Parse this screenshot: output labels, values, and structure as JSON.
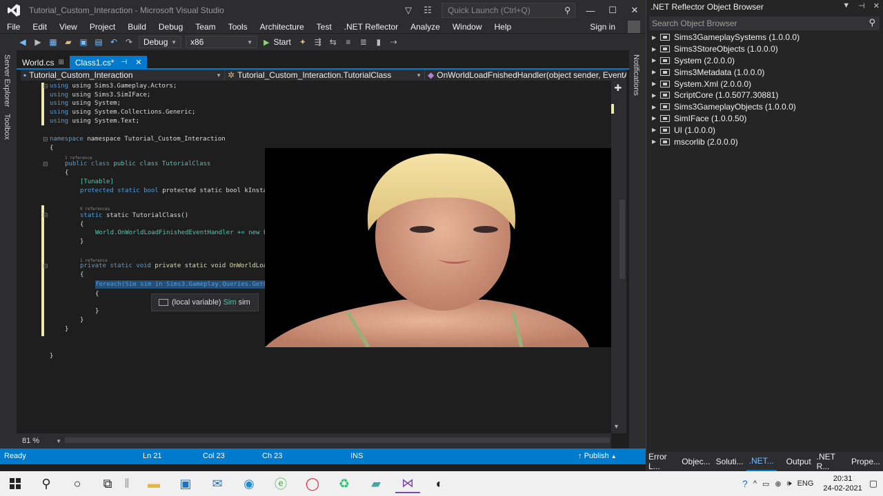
{
  "window": {
    "title": "Tutorial_Custom_Interaction - Microsoft Visual Studio",
    "quick_launch_placeholder": "Quick Launch (Ctrl+Q)",
    "sign_in": "Sign in"
  },
  "menu": [
    "File",
    "Edit",
    "View",
    "Project",
    "Build",
    "Debug",
    "Team",
    "Tools",
    "Architecture",
    "Test",
    ".NET Reflector",
    "Analyze",
    "Window",
    "Help"
  ],
  "toolbar": {
    "config": "Debug",
    "platform": "x86",
    "start_label": "Start"
  },
  "side_tabs": {
    "left": [
      "Server Explorer",
      "Toolbox"
    ],
    "right": [
      "Notifications"
    ]
  },
  "doc_tabs": [
    {
      "label": "World.cs"
    },
    {
      "label": "Class1.cs*"
    }
  ],
  "nav": {
    "project": "Tutorial_Custom_Interaction",
    "class": "Tutorial_Custom_Interaction.TutorialClass",
    "member": "OnWorldLoadFnishedHandler(object sender, EventA"
  },
  "code": {
    "lines": [
      {
        "t": "using Sims3.Gameplay.Actors;"
      },
      {
        "t": "using Sims3.SimIFace;"
      },
      {
        "t": "using System;"
      },
      {
        "t": "using System.Collections.Generic;"
      },
      {
        "t": "using System.Text;"
      },
      {
        "t": "namespace Tutorial_Custom_Interaction"
      },
      {
        "t": "{"
      },
      {
        "t": "1 reference"
      },
      {
        "t": "public class TutorialClass"
      },
      {
        "t": "{"
      },
      {
        "t": "[Tunable]"
      },
      {
        "t": "protected static bool kInstantiator = false;"
      },
      {
        "t": "0 references"
      },
      {
        "t": "static TutorialClass()"
      },
      {
        "t": "{"
      },
      {
        "t": "World.OnWorldLoadFinishedEventHandler += new E"
      },
      {
        "t": "}"
      },
      {
        "t": "1 reference"
      },
      {
        "t": "private static void OnWorldLoadFnishedHandler(obje"
      },
      {
        "t": "{"
      },
      {
        "t": "foreach(Sim sim in Sims3.Gameplay.Queries.GetO"
      },
      {
        "t": "{"
      },
      {
        "t": "}"
      },
      {
        "t": "}"
      },
      {
        "t": "}"
      },
      {
        "t": "}"
      }
    ]
  },
  "tooltip": {
    "prefix": "(local variable)",
    "type": "Sim",
    "name": "sim"
  },
  "zoom": "81 %",
  "status": {
    "state": "Ready",
    "ln": "Ln 21",
    "col": "Col 23",
    "ch": "Ch 23",
    "mode": "INS",
    "publish": "Publish"
  },
  "reflector": {
    "title": ".NET Reflector Object Browser",
    "search_placeholder": "Search Object Browser",
    "assemblies": [
      "Sims3GameplaySystems (1.0.0.0)",
      "Sims3StoreObjects (1.0.0.0)",
      "System (2.0.0.0)",
      "Sims3Metadata (1.0.0.0)",
      "System.Xml (2.0.0.0)",
      "ScriptCore (1.0.5077.30881)",
      "Sims3GameplayObjects (1.0.0.0)",
      "SimIFace (1.0.0.50)",
      "UI (1.0.0.0)",
      "mscorlib (2.0.0.0)"
    ]
  },
  "bottom_tabs": [
    "Error L...",
    "Objec...",
    "Soluti...",
    ".NET...",
    "Output",
    ".NET R...",
    "Prope..."
  ],
  "taskbar": {
    "lang": "ENG",
    "time": "20:31",
    "date": "24-02-2021"
  },
  "colors": {
    "accent": "#007acc",
    "editor_bg": "#1e1e1e",
    "chrome_bg": "#2d2d30",
    "keyword": "#569cd6",
    "type": "#4ec9b0"
  }
}
